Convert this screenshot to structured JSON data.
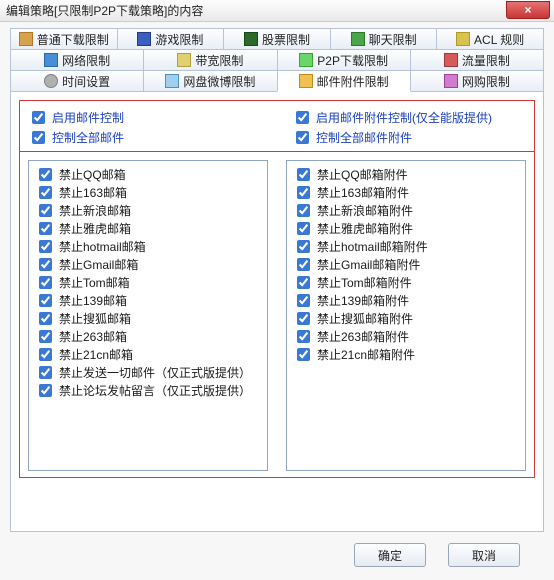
{
  "window": {
    "title": "编辑策略[只限制P2P下载策略]的内容",
    "close_label": "×"
  },
  "tabs_row1": [
    {
      "label": "普通下载限制",
      "icon": "i-dl"
    },
    {
      "label": "游戏限制",
      "icon": "i-game"
    },
    {
      "label": "股票限制",
      "icon": "i-stock"
    },
    {
      "label": "聊天限制",
      "icon": "i-chat"
    },
    {
      "label": "ACL 规则",
      "icon": "i-acl"
    }
  ],
  "tabs_row2": [
    {
      "label": "网络限制",
      "icon": "i-net"
    },
    {
      "label": "带宽限制",
      "icon": "i-bw"
    },
    {
      "label": "P2P下载限制",
      "icon": "i-p2p"
    },
    {
      "label": "流量限制",
      "icon": "i-flow"
    }
  ],
  "tabs_row3": [
    {
      "label": "时间设置",
      "icon": "i-time"
    },
    {
      "label": "网盘微博限制",
      "icon": "i-pan"
    },
    {
      "label": "邮件附件限制",
      "icon": "i-mail",
      "active": true
    },
    {
      "label": "网购限制",
      "icon": "i-shop"
    }
  ],
  "top_options": {
    "left": [
      {
        "label": "启用邮件控制"
      },
      {
        "label": "控制全部邮件"
      }
    ],
    "right": [
      {
        "label": "启用邮件附件控制(仅全能版提供)"
      },
      {
        "label": "控制全部邮件附件"
      }
    ]
  },
  "left_list": [
    "禁止QQ邮箱",
    "禁止163邮箱",
    "禁止新浪邮箱",
    "禁止雅虎邮箱",
    "禁止hotmail邮箱",
    "禁止Gmail邮箱",
    "禁止Tom邮箱",
    "禁止139邮箱",
    "禁止搜狐邮箱",
    "禁止263邮箱",
    "禁止21cn邮箱",
    "禁止发送一切邮件（仅正式版提供）",
    "禁止论坛发帖留言（仅正式版提供）"
  ],
  "right_list": [
    "禁止QQ邮箱附件",
    "禁止163邮箱附件",
    "禁止新浪邮箱附件",
    "禁止雅虎邮箱附件",
    "禁止hotmail邮箱附件",
    "禁止Gmail邮箱附件",
    "禁止Tom邮箱附件",
    "禁止139邮箱附件",
    "禁止搜狐邮箱附件",
    "禁止263邮箱附件",
    "禁止21cn邮箱附件"
  ],
  "footer": {
    "ok": "确定",
    "cancel": "取消"
  }
}
